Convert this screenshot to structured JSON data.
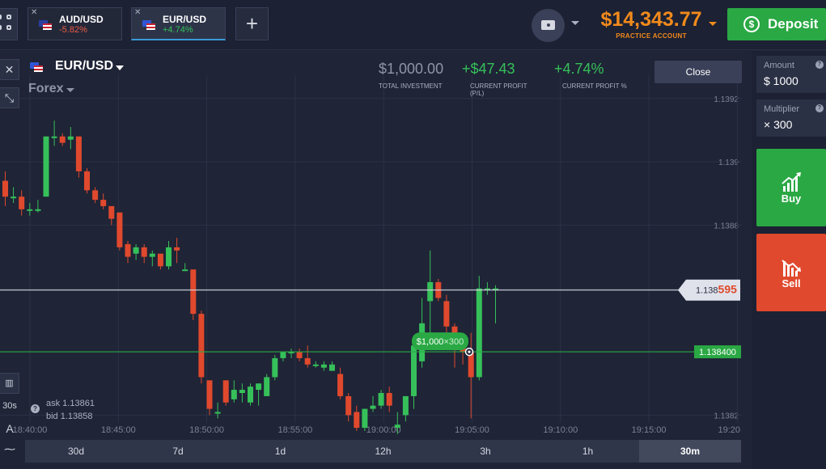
{
  "tabs": [
    {
      "name": "AUD/USD",
      "change": "-5.82%",
      "direction": "down",
      "active": false
    },
    {
      "name": "EUR/USD",
      "change": "+4.74%",
      "direction": "up",
      "active": true
    }
  ],
  "add_tab_label": "+",
  "balance": {
    "amount": "$14,343.77",
    "label": "PRACTICE ACCOUNT"
  },
  "deposit_label": "Deposit",
  "chart_header": {
    "pair": "EUR/USD",
    "category": "Forex",
    "investment": "$1,000.00",
    "investment_label": "TOTAL INVESTMENT",
    "profit": "+$47.43",
    "profit_label": "CURRENT PROFIT (P/L)",
    "profit_pct": "+4.74%",
    "profit_pct_label": "CURRENT PROFIT %",
    "close_label": "Close"
  },
  "quote": {
    "ask": "ask 1.13861",
    "bid": "bid 1.13858"
  },
  "left_tools": {
    "interval": "30s"
  },
  "price_markers": {
    "current_prefix": "1.138",
    "current_suffix": "595",
    "entry": "1.138400",
    "position_tag_amount": "$1,000",
    "position_tag_mult": "×300"
  },
  "periods": [
    {
      "label": "30d",
      "selected": false
    },
    {
      "label": "7d",
      "selected": false
    },
    {
      "label": "1d",
      "selected": false
    },
    {
      "label": "12h",
      "selected": false
    },
    {
      "label": "3h",
      "selected": false
    },
    {
      "label": "1h",
      "selected": false
    },
    {
      "label": "30m",
      "selected": true
    }
  ],
  "panel": {
    "amount_label": "Amount",
    "amount_value": "$ 1000",
    "multiplier_label": "Multiplier",
    "multiplier_value": "× 300",
    "buy_label": "Buy",
    "sell_label": "Sell"
  },
  "colors": {
    "up": "#36c05a",
    "down": "#e0492d",
    "balance": "#f28a1c",
    "deposit": "#2aa844"
  },
  "chart_data": {
    "type": "candlestick",
    "y_ticks": [
      "1.1392",
      "1.139",
      "1.1388",
      "1.1386",
      "1.1384",
      "1.1382"
    ],
    "x_ticks": [
      "18:40:00",
      "18:45:00",
      "18:50:00",
      "18:55:00",
      "19:00:00",
      "19:05:00",
      "19:10:00",
      "19:15:00",
      "19:20"
    ],
    "ylim": [
      1.13815,
      1.13935
    ],
    "current_price": 1.138595,
    "entry_price": 1.1384,
    "grid": true,
    "candles": [
      [
        1.13894,
        1.13889,
        1.13897,
        1.13886
      ],
      [
        1.13889,
        1.13889,
        1.13892,
        1.13887
      ],
      [
        1.13889,
        1.13885,
        1.13891,
        1.13883
      ],
      [
        1.13885,
        1.13885,
        1.13887,
        1.13883
      ],
      [
        1.13885,
        1.13885,
        1.13888,
        1.13884
      ],
      [
        1.13889,
        1.13908,
        1.13908,
        1.13889
      ],
      [
        1.13908,
        1.13908,
        1.13913,
        1.13905
      ],
      [
        1.13908,
        1.13906,
        1.13909,
        1.13905
      ],
      [
        1.13907,
        1.13908,
        1.13911,
        1.13904
      ],
      [
        1.13908,
        1.13897,
        1.13908,
        1.13895
      ],
      [
        1.13897,
        1.13891,
        1.13898,
        1.1389
      ],
      [
        1.13891,
        1.13888,
        1.13892,
        1.13887
      ],
      [
        1.13888,
        1.13886,
        1.1389,
        1.13885
      ],
      [
        1.13886,
        1.13882,
        1.13886,
        1.1388
      ],
      [
        1.13884,
        1.13873,
        1.13884,
        1.13872
      ],
      [
        1.13874,
        1.1387,
        1.13875,
        1.13868
      ],
      [
        1.13871,
        1.13873,
        1.13874,
        1.13869
      ],
      [
        1.13873,
        1.1387,
        1.13874,
        1.13868
      ],
      [
        1.1387,
        1.13871,
        1.13872,
        1.13867
      ],
      [
        1.13871,
        1.13867,
        1.13871,
        1.13866
      ],
      [
        1.13867,
        1.13873,
        1.13875,
        1.13866
      ],
      [
        1.13873,
        1.13872,
        1.13876,
        1.13868
      ],
      [
        1.13866,
        1.13866,
        1.13868,
        1.13866
      ],
      [
        1.13866,
        1.13852,
        1.13866,
        1.1385
      ],
      [
        1.13852,
        1.13832,
        1.13853,
        1.1383
      ],
      [
        1.13831,
        1.13822,
        1.13831,
        1.1382
      ],
      [
        1.13821,
        1.13821,
        1.13824,
        1.13819
      ],
      [
        1.13831,
        1.13824,
        1.13831,
        1.13823
      ],
      [
        1.13825,
        1.13828,
        1.13831,
        1.13824
      ],
      [
        1.13827,
        1.13828,
        1.1383,
        1.13824
      ],
      [
        1.13824,
        1.13829,
        1.1383,
        1.13823
      ],
      [
        1.13828,
        1.1383,
        1.1383,
        1.13823
      ],
      [
        1.13826,
        1.13832,
        1.13833,
        1.13826
      ],
      [
        1.13832,
        1.13838,
        1.13839,
        1.13831
      ],
      [
        1.13838,
        1.1384,
        1.1384,
        1.13837
      ],
      [
        1.1384,
        1.1384,
        1.13841,
        1.13838
      ],
      [
        1.1384,
        1.13838,
        1.13841,
        1.13837
      ],
      [
        1.13838,
        1.13836,
        1.13842,
        1.13835
      ],
      [
        1.13836,
        1.13836,
        1.13837,
        1.13835
      ],
      [
        1.13835,
        1.13836,
        1.13837,
        1.13834
      ],
      [
        1.13834,
        1.13836,
        1.13837,
        1.13834
      ],
      [
        1.13833,
        1.13826,
        1.13835,
        1.13825
      ],
      [
        1.13826,
        1.1382,
        1.13827,
        1.13818
      ],
      [
        1.13821,
        1.13816,
        1.13823,
        1.13815
      ],
      [
        1.13816,
        1.13822,
        1.13822,
        1.13815
      ],
      [
        1.13822,
        1.13823,
        1.13826,
        1.13821
      ],
      [
        1.13823,
        1.13827,
        1.13828,
        1.13822
      ],
      [
        1.13827,
        1.13823,
        1.13829,
        1.13821
      ],
      [
        1.13816,
        1.13817,
        1.13821,
        1.13814
      ],
      [
        1.1382,
        1.13826,
        1.13826,
        1.13818
      ],
      [
        1.13826,
        1.13842,
        1.13844,
        1.13822
      ],
      [
        1.13837,
        1.13849,
        1.13857,
        1.13835
      ],
      [
        1.13856,
        1.13862,
        1.13872,
        1.13844
      ],
      [
        1.13862,
        1.13857,
        1.13863,
        1.13856
      ],
      [
        1.13856,
        1.13848,
        1.13858,
        1.13846
      ],
      [
        1.13848,
        1.13845,
        1.13849,
        1.13835
      ],
      [
        1.13845,
        1.1384,
        1.13845,
        1.13836
      ],
      [
        1.1384,
        1.13832,
        1.13846,
        1.13819
      ],
      [
        1.13832,
        1.1386,
        1.13864,
        1.13831
      ],
      [
        1.1386,
        1.1386,
        1.13862,
        1.13858
      ],
      [
        1.1386,
        1.1386,
        1.13861,
        1.13849
      ]
    ]
  }
}
